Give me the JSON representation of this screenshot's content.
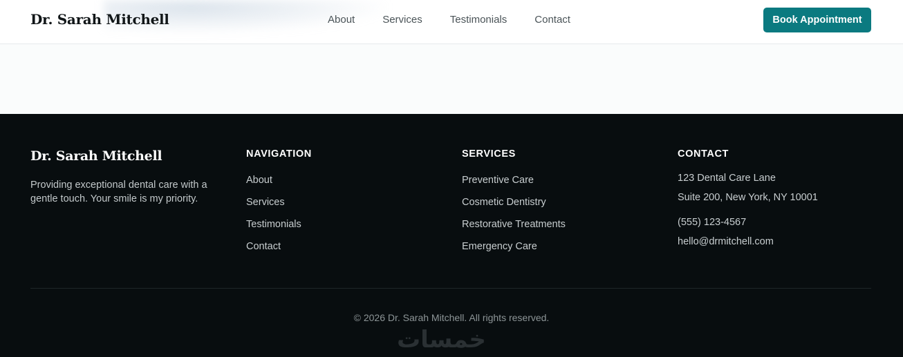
{
  "header": {
    "brand": "Dr. Sarah Mitchell",
    "nav": [
      "About",
      "Services",
      "Testimonials",
      "Contact"
    ],
    "cta": "Book Appointment"
  },
  "footer": {
    "brand": "Dr. Sarah Mitchell",
    "tagline": "Providing exceptional dental care with a gentle touch. Your smile is my priority.",
    "navigation": {
      "title": "NAVIGATION",
      "items": [
        "About",
        "Services",
        "Testimonials",
        "Contact"
      ]
    },
    "services": {
      "title": "SERVICES",
      "items": [
        "Preventive Care",
        "Cosmetic Dentistry",
        "Restorative Treatments",
        "Emergency Care"
      ]
    },
    "contact": {
      "title": "CONTACT",
      "address_line1": "123 Dental Care Lane",
      "address_line2": "Suite 200, New York, NY 10001",
      "phone": "(555) 123-4567",
      "email": "hello@drmitchell.com"
    },
    "copyright": "© 2026 Dr. Sarah Mitchell. All rights reserved.",
    "watermark": "خمسات"
  },
  "colors": {
    "accent": "#0b7a80",
    "footer_bg": "#080d0f",
    "page_bg": "#fafcfc"
  }
}
